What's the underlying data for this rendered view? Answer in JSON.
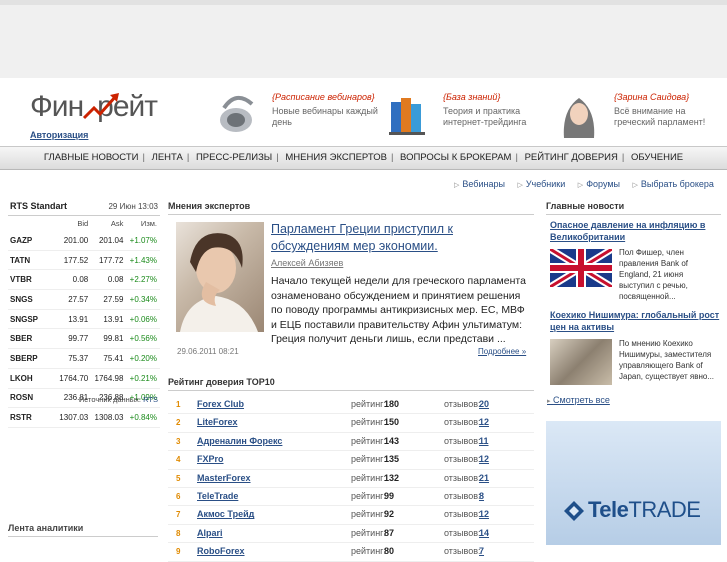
{
  "header": {
    "logo_text": "Финрейт",
    "auth_link": "Авторизация",
    "promos": [
      {
        "title": "{Расписание вебинаров}",
        "desc": "Новые вебинары каждый день",
        "icon": "headset-icon"
      },
      {
        "title": "{База знаний}",
        "desc": "Теория и практика интернет-трейдинга",
        "icon": "books-icon"
      },
      {
        "title": "{Зарина Саидова}",
        "desc": "Всё внимание на греческий парламент!",
        "icon": "person-photo"
      }
    ]
  },
  "nav": {
    "items": [
      "ГЛАВНЫЕ НОВОСТИ",
      "ЛЕНТА",
      "ПРЕСС-РЕЛИЗЫ",
      "МНЕНИЯ ЭКСПЕРТОВ",
      "ВОПРОСЫ К БРОКЕРАМ",
      "РЕЙТИНГ ДОВЕРИЯ",
      "ОБУЧЕНИЕ"
    ],
    "separator": "|"
  },
  "sublinks": [
    "Вебинары",
    "Учебники",
    "Форумы",
    "Выбрать брокера"
  ],
  "rts": {
    "title": "RTS Standart",
    "date": "29 Июн 13:03",
    "columns": [
      "Bid",
      "Ask",
      "Изм."
    ],
    "rows": [
      {
        "name": "GAZP",
        "bid": "201.00",
        "ask": "201.04",
        "chg": "+1.07%"
      },
      {
        "name": "TATN",
        "bid": "177.52",
        "ask": "177.72",
        "chg": "+1.43%"
      },
      {
        "name": "VTBR",
        "bid": "0.08",
        "ask": "0.08",
        "chg": "+2.27%"
      },
      {
        "name": "SNGS",
        "bid": "27.57",
        "ask": "27.59",
        "chg": "+0.34%"
      },
      {
        "name": "SNGSP",
        "bid": "13.91",
        "ask": "13.91",
        "chg": "+0.06%"
      },
      {
        "name": "SBER",
        "bid": "99.77",
        "ask": "99.81",
        "chg": "+0.56%"
      },
      {
        "name": "SBERP",
        "bid": "75.37",
        "ask": "75.41",
        "chg": "+0.20%"
      },
      {
        "name": "LKOH",
        "bid": "1764.70",
        "ask": "1764.98",
        "chg": "+0.21%"
      },
      {
        "name": "ROSN",
        "bid": "236.81",
        "ask": "236.88",
        "chg": "+1.09%"
      },
      {
        "name": "RSTR",
        "bid": "1307.03",
        "ask": "1308.03",
        "chg": "+0.84%"
      }
    ],
    "source_label": "Источник данных:",
    "source_link": "RTS",
    "positive_color": "#1a8a1a"
  },
  "lenta_title": "Лента аналитики",
  "experts": {
    "section_title": "Мнения экспертов",
    "title": "Парламент Греции приступил к обсуждениям мер экономии.",
    "author": "Алексей Абизяев",
    "text": "Начало текущей недели для греческого парламента ознаменовано обсуждением и принятием решения по поводу программы антикризисных мер. ЕС, МВФ и ЕЦБ поставили правительству Афин ультиматум: Греция получит деньги лишь, если представи ...",
    "date": "29.06.2011 08:21",
    "more": "Подробнее »"
  },
  "rating": {
    "section_title": "Рейтинг доверия TOP10",
    "rating_label": "рейтинг:",
    "reviews_label": "отзывов:",
    "rows": [
      {
        "idx": "1",
        "name": "Forex Club",
        "rating": "180",
        "reviews": "20"
      },
      {
        "idx": "2",
        "name": "LiteForex",
        "rating": "150",
        "reviews": "12"
      },
      {
        "idx": "3",
        "name": "Адреналин Форекс",
        "rating": "143",
        "reviews": "11"
      },
      {
        "idx": "4",
        "name": "FXPro",
        "rating": "135",
        "reviews": "12"
      },
      {
        "idx": "5",
        "name": "MasterForex",
        "rating": "132",
        "reviews": "21"
      },
      {
        "idx": "6",
        "name": "TeleTrade",
        "rating": "99",
        "reviews": "8"
      },
      {
        "idx": "7",
        "name": "Акмос Трейд",
        "rating": "92",
        "reviews": "12"
      },
      {
        "idx": "8",
        "name": "Alpari",
        "rating": "87",
        "reviews": "14"
      },
      {
        "idx": "9",
        "name": "RoboForex",
        "rating": "80",
        "reviews": "7"
      }
    ]
  },
  "news": {
    "section_title": "Главные новости",
    "items": [
      {
        "title": "Опасное давление на инфляцию в Великобритании",
        "desc": "Пол Фишер, член правления Bank of England, 21 июня выступил с речью, посвященной..."
      },
      {
        "title": "Коехико Нишимура: глобальный рост цен на активы",
        "desc": "По мнению Коехико Нишимуры, заместителя управляющего Bank of Japan, существует явно..."
      }
    ],
    "see_all": "Смотреть все"
  },
  "banner": {
    "brand": "TeleTRADE",
    "brand_a": "Tele",
    "brand_b": "TRADE"
  }
}
